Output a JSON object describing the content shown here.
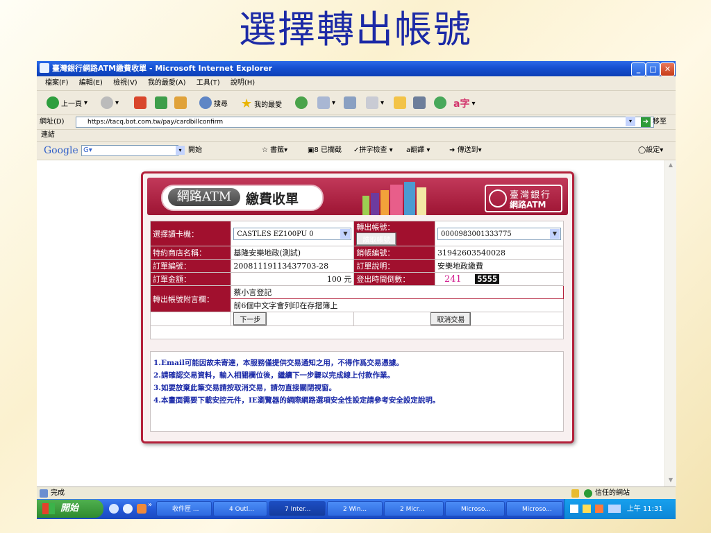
{
  "slide": {
    "title": "選擇轉出帳號"
  },
  "window": {
    "title": "臺灣銀行網路ATM繳費收單 - Microsoft Internet Explorer",
    "menu": [
      "檔案(F)",
      "編輯(E)",
      "檢視(V)",
      "我的最愛(A)",
      "工具(T)",
      "說明(H)"
    ],
    "toolbar": {
      "back": "上一頁",
      "search": "搜尋",
      "favorites": "我的最愛"
    },
    "address_label": "網址(D)",
    "address": "https://tacq.bot.com.tw/pay/cardbillconfirm",
    "go": "移至",
    "links": "連結",
    "google": {
      "brand": "Google",
      "g": "G",
      "start": "開始",
      "bookmarks": "書籤",
      "blocked": "8 已攔截",
      "spell": "拼字檢查",
      "translate": "翻譯",
      "send": "傳送到",
      "settings": "設定"
    }
  },
  "form": {
    "header": {
      "atm": "網路ATM",
      "bill": "繳費收單",
      "bank_top": "臺灣銀行",
      "bank_bottom": "網路ATM"
    },
    "reader_label": "選擇讀卡機：",
    "reader_value": "CASTLES EZ100PU 0",
    "acct_label": "轉出帳號：",
    "read_btn": "讀取帳號",
    "acct_value": "0000983001333775",
    "merchant_label": "特約商店名稱：",
    "merchant_value": "基隆安樂地政(測試)",
    "sale_acct_label": "銷帳編號：",
    "sale_acct_value": "31942603540028",
    "order_label": "訂單編號：",
    "order_value": "20081119113437703-28",
    "desc_label": "訂單說明：",
    "desc_value": "安樂地政繳費",
    "amount_label": "訂單金額：",
    "amount_value": "100 元",
    "countdown_label": "登出時間倒數：",
    "countdown_value": "241",
    "countdown_badge": "5555",
    "memo_label": "轉出帳號附言欄：",
    "memo_value": "蔡小言登記",
    "memo_hint": "前6個中文字會列印在存摺簿上",
    "next_btn": "下一步",
    "cancel_btn": "取消交易",
    "notes": [
      "1.Email可能因故未寄達，本服務僅提供交易通知之用，不得作爲交易憑據。",
      "2.請確認交易資料，輸入相關欄位後，繼續下一步驟以完成線上付款作業。",
      "3.如要放棄此筆交易請按取消交易，請勿直接關閉視窗。",
      "4.本畫面需要下載安控元件，IE瀏覽器的網際網路選項安全性設定請參考安全設定說明。"
    ]
  },
  "status": {
    "done": "完成",
    "zone": "信任的網站"
  },
  "taskbar": {
    "start": "開始",
    "tasks": [
      "收件匣 ...",
      "4 Outl...",
      "7 Inter...",
      "2 Win...",
      "2 Micr...",
      "Microso...",
      "Microso..."
    ],
    "clock": "上午 11:31"
  }
}
